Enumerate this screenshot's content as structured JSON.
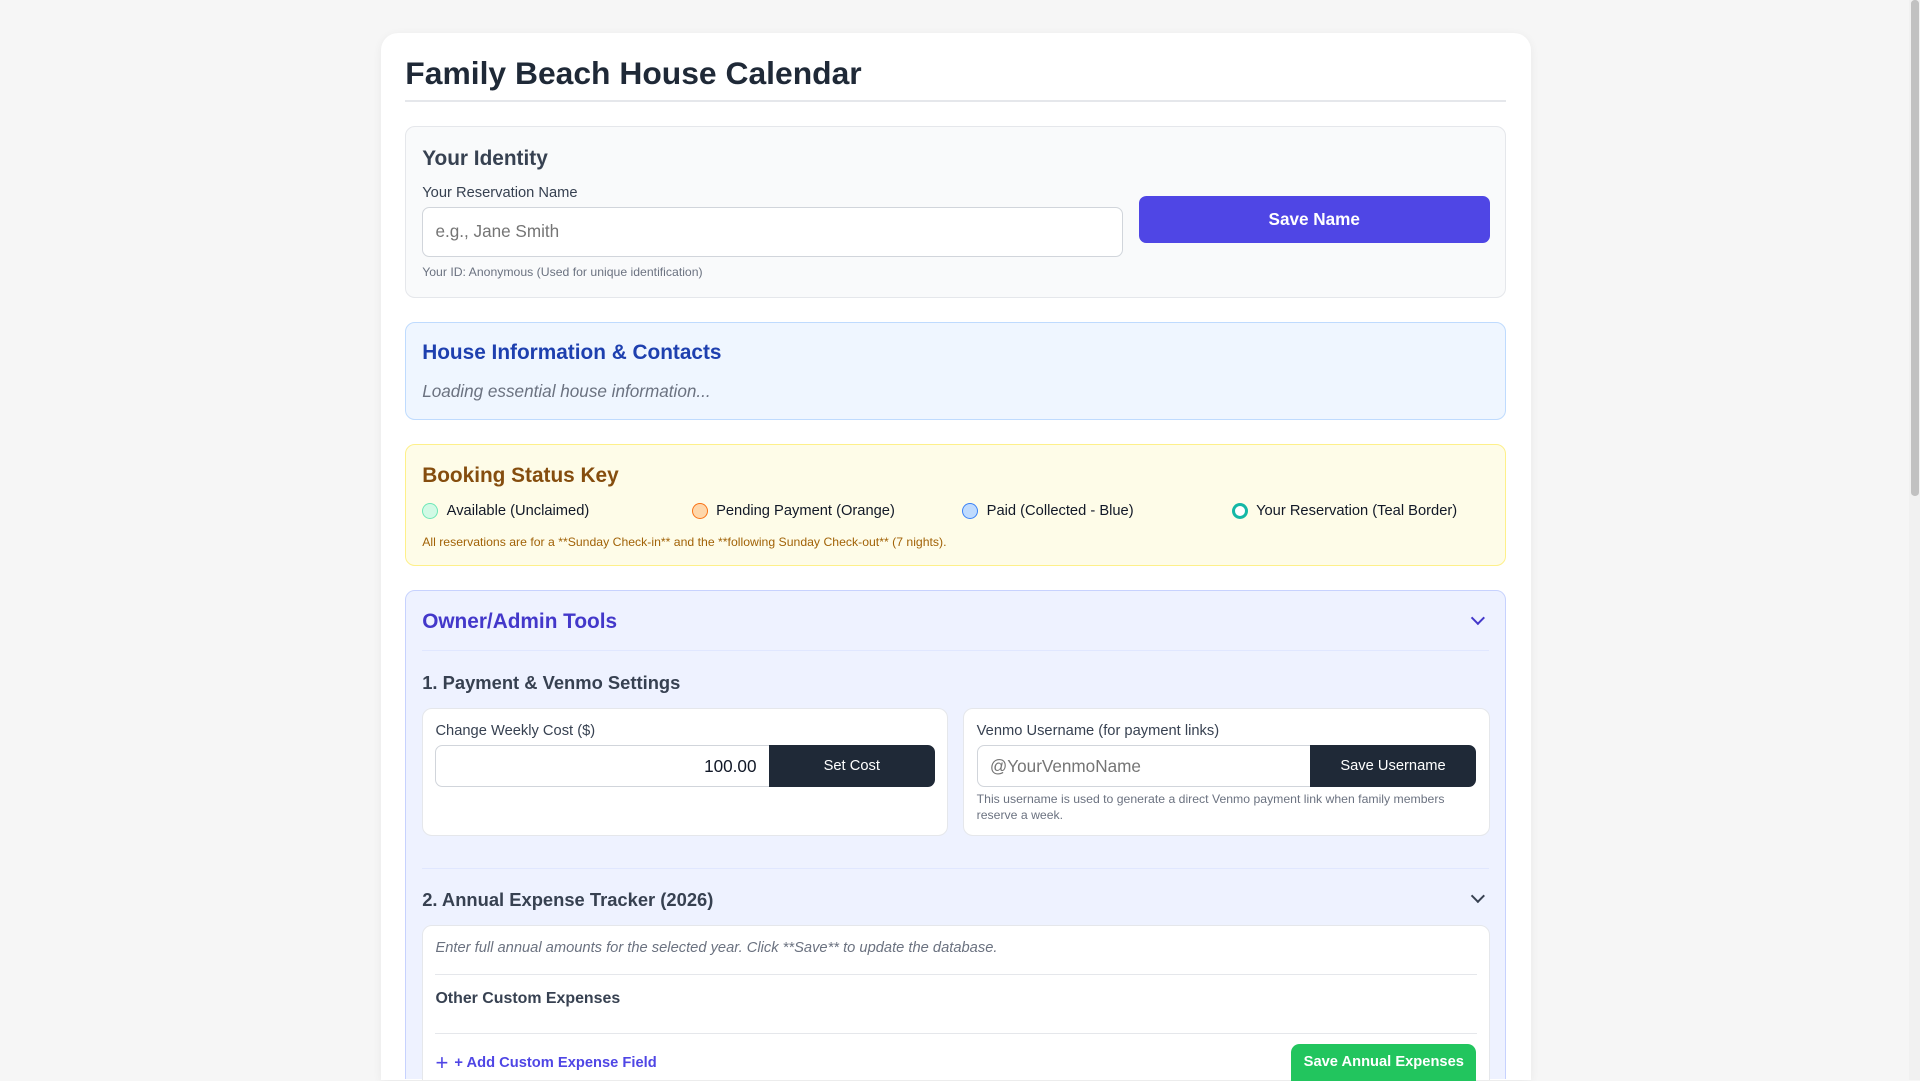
{
  "title": "Family Beach House Calendar",
  "identity": {
    "heading": "Your Identity",
    "label": "Your Reservation Name",
    "placeholder": "e.g., Jane Smith",
    "save_label": "Save Name",
    "id_text": "Your ID: Anonymous (Used for unique identification)"
  },
  "house": {
    "heading": "House Information & Contacts",
    "loading": "Loading essential house information..."
  },
  "key": {
    "heading": "Booking Status Key",
    "items": [
      {
        "label": "Available (Unclaimed)",
        "color": "#d1fae5"
      },
      {
        "label": "Pending Payment (Orange)",
        "color": "#fed7aa"
      },
      {
        "label": "Paid (Collected - Blue)",
        "color": "#bfdbfe"
      },
      {
        "label": "Your Reservation (Teal Border)",
        "color": "#14b8a6"
      }
    ],
    "note": "All reservations are for a **Sunday Check-in** and the **following Sunday Check-out** (7 nights)."
  },
  "admin": {
    "heading": "Owner/Admin Tools",
    "payment": {
      "heading": "1. Payment & Venmo Settings",
      "cost_label": "Change Weekly Cost ($)",
      "cost_value": "100.00",
      "set_cost": "Set Cost",
      "venmo_label": "Venmo Username (for payment links)",
      "venmo_placeholder": "@YourVenmoName",
      "save_username": "Save Username",
      "venmo_help": "This username is used to generate a direct Venmo payment link when family members reserve a week."
    },
    "expenses": {
      "heading": "2. Annual Expense Tracker (2026)",
      "instructions": "Enter full annual amounts for the selected year. Click **Save** to update the database.",
      "other_heading": "Other Custom Expenses",
      "add_label": "+ Add Custom Expense Field",
      "save_label": "Save Annual Expenses"
    }
  }
}
